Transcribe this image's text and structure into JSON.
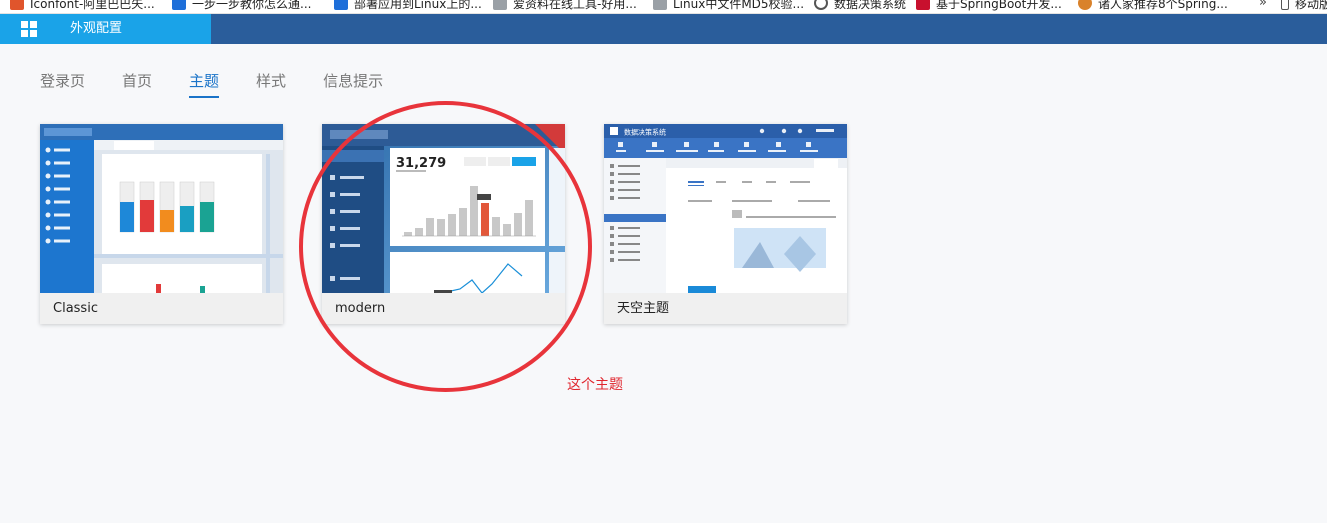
{
  "bookmarks": [
    {
      "label": "Iconfont-阿里巴巴矢...",
      "color": "#e0552c"
    },
    {
      "label": "一步一步教你怎么通...",
      "color": "#1e6fd9"
    },
    {
      "label": "部署应用到Linux上的...",
      "color": "#1e6fd9"
    },
    {
      "label": "爱资料在线工具-好用...",
      "color": "#9aa0a6"
    },
    {
      "label": "Linux中文件MD5校验...",
      "color": "#9aa0a6"
    },
    {
      "label": "数据决策系统",
      "color": "#555555"
    },
    {
      "label": "基于SpringBoot开发...",
      "color": "#c8102e"
    },
    {
      "label": "诸人家推荐8个Spring...",
      "color": "#d9822b"
    },
    {
      "label": "移动版",
      "color": "#555555"
    }
  ],
  "appbar": {
    "tab_label": "外观配置"
  },
  "nav": [
    "登录页",
    "首页",
    "主题",
    "样式",
    "信息提示"
  ],
  "themes": [
    {
      "name": "Classic"
    },
    {
      "name": "modern",
      "thumb_big_number": "31,279"
    },
    {
      "name": "天空主题",
      "thumb_title": "数据决策系统"
    }
  ],
  "annotation": {
    "text": "这个主题"
  },
  "colors": {
    "appbar": "#2a5d9b",
    "accent": "#1aa3e8",
    "annotation": "#e8343b",
    "active_tab": "#1a73c8"
  }
}
